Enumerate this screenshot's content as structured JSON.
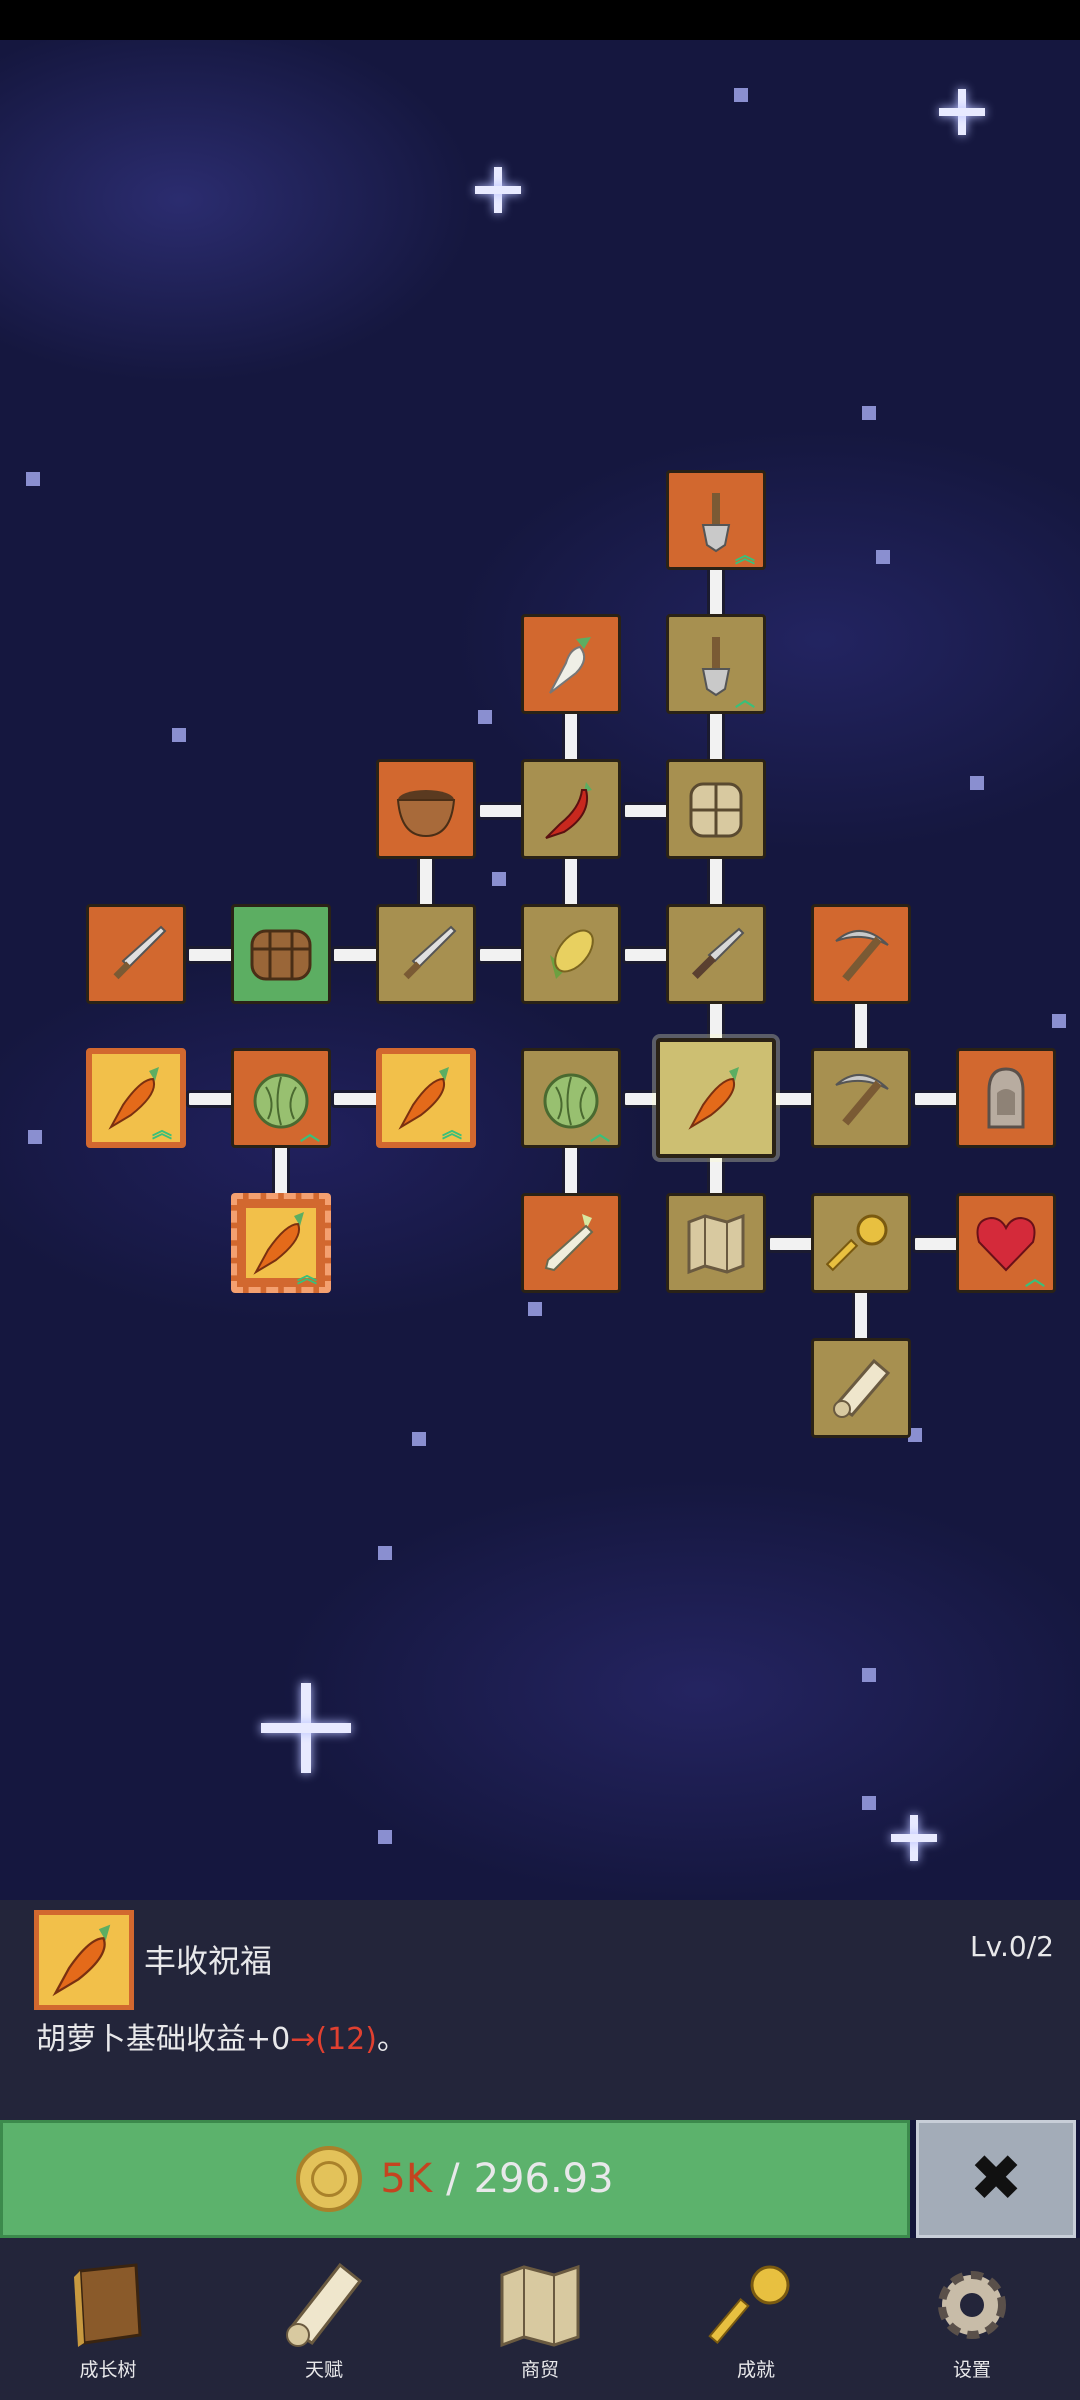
{
  "skill_tree": {
    "nodes": [
      {
        "icon": "shovel-icon",
        "style": "orange",
        "upgrade_arrow": true
      },
      {
        "icon": "white-radish-icon",
        "style": "orange",
        "upgrade_arrow": false
      },
      {
        "icon": "shovel-icon",
        "style": "olive",
        "upgrade_arrow": true
      },
      {
        "icon": "bowl-icon",
        "style": "orange",
        "upgrade_arrow": false
      },
      {
        "icon": "chili-pepper-icon",
        "style": "olive",
        "upgrade_arrow": false
      },
      {
        "icon": "backpack-icon",
        "style": "olive",
        "upgrade_arrow": false
      },
      {
        "icon": "sword-icon",
        "style": "orange",
        "upgrade_arrow": false
      },
      {
        "icon": "chest-icon",
        "style": "green",
        "upgrade_arrow": false
      },
      {
        "icon": "sword-icon",
        "style": "olive",
        "upgrade_arrow": false
      },
      {
        "icon": "corn-icon",
        "style": "olive",
        "upgrade_arrow": false
      },
      {
        "icon": "dagger-icon",
        "style": "olive",
        "upgrade_arrow": false
      },
      {
        "icon": "pickaxe-icon",
        "style": "orange",
        "upgrade_arrow": false
      },
      {
        "icon": "golden-carrot-icon",
        "style": "gold",
        "upgrade_arrow": true
      },
      {
        "icon": "cabbage-icon",
        "style": "orange",
        "upgrade_arrow": true
      },
      {
        "icon": "golden-carrot-icon",
        "style": "gold",
        "upgrade_arrow": true
      },
      {
        "icon": "cabbage-icon",
        "style": "olive",
        "upgrade_arrow": true
      },
      {
        "icon": "carrot-icon",
        "style": "selected",
        "upgrade_arrow": false
      },
      {
        "icon": "pickaxe-icon",
        "style": "olive",
        "upgrade_arrow": false
      },
      {
        "icon": "statue-icon",
        "style": "orange",
        "upgrade_arrow": false
      },
      {
        "icon": "golden-carrot-icon",
        "style": "gold-dashed",
        "upgrade_arrow": true
      },
      {
        "icon": "leek-icon",
        "style": "orange",
        "upgrade_arrow": false
      },
      {
        "icon": "map-icon",
        "style": "olive",
        "upgrade_arrow": false
      },
      {
        "icon": "key-icon",
        "style": "olive",
        "upgrade_arrow": false
      },
      {
        "icon": "heart-icon",
        "style": "orange",
        "upgrade_arrow": true
      },
      {
        "icon": "scroll-icon",
        "style": "olive",
        "upgrade_arrow": false
      }
    ]
  },
  "info_panel": {
    "icon": "golden-carrot-icon",
    "title": "丰收祝福",
    "level": "Lv.0/2",
    "desc_prefix": "胡萝卜基础收益+0",
    "desc_arrow": "→",
    "desc_value": "(12)",
    "desc_suffix": "。"
  },
  "purchase": {
    "cost": "5K",
    "separator": "/",
    "balance": "296.93",
    "close_symbol": "✖"
  },
  "bottom_nav": [
    {
      "label": "成长树",
      "icon": "book-icon"
    },
    {
      "label": "天赋",
      "icon": "scroll-icon"
    },
    {
      "label": "商贸",
      "icon": "map-icon"
    },
    {
      "label": "成就",
      "icon": "key-icon"
    },
    {
      "label": "设置",
      "icon": "gear-icon"
    }
  ],
  "colors": {
    "node_orange": "#d2682f",
    "node_olive": "#a79050",
    "node_green": "#5cae62",
    "buy_green": "#5cb26c",
    "cost_red": "#c44420",
    "panel_bg": "#23253a"
  }
}
